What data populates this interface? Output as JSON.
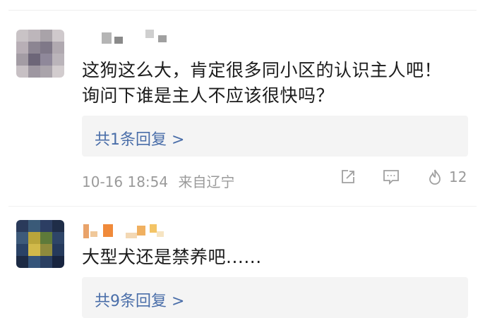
{
  "comments": [
    {
      "text_line1": "这狗这么大，肯定很多同小区的认识主人吧！",
      "text_line2": "询问下谁是主人不应该很快吗？",
      "replies_label": "共1条回复 >",
      "date": "10-16 18:54",
      "location": "来自辽宁",
      "like_count": "12"
    },
    {
      "text_line1": "大型犬还是禁养吧......",
      "replies_label": "共9条回复 >"
    }
  ],
  "colors": {
    "link": "#4a6ea9",
    "meta": "#9a9a9a",
    "reply_bg": "#f4f4f4"
  },
  "icons": [
    "share-icon",
    "comment-icon",
    "like-icon"
  ]
}
